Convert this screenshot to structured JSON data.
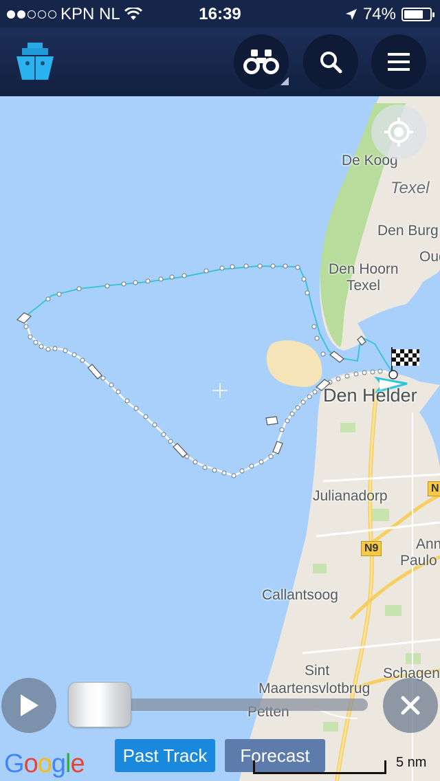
{
  "status_bar": {
    "carrier": "KPN NL",
    "signal_dots_filled": 2,
    "signal_dots_total": 5,
    "time": "16:39",
    "battery": "74%",
    "battery_level": 0.74
  },
  "app_bar": {
    "logo_icon": "ship-icon",
    "buttons": [
      "binoculars-icon",
      "search-icon",
      "hamburger-menu-icon"
    ]
  },
  "map": {
    "places": {
      "de_koog": "De Koog",
      "texel": "Texel",
      "den_burg": "Den Burg",
      "oud": "Oud",
      "den_hoorn": "Den Hoorn",
      "den_hoorn_texel": "Texel",
      "den_helder": "Den Helder",
      "julianadorp": "Julianadorp",
      "anna_paulowna_1": "Ann",
      "anna_paulowna_2": "Paulo",
      "callantsoog": "Callantsoog",
      "sint": "Sint",
      "maartensvlotbrug": "Maartensvlotbrug",
      "schagen": "Schagen",
      "petten": "Petten"
    },
    "road_signs": {
      "n9": "N9",
      "n_edge": "N"
    },
    "locate_icon": "crosshair-locate-icon"
  },
  "controls": {
    "play_icon": "play-icon",
    "close_icon": "close-icon",
    "slider_position": 0.0,
    "tabs": {
      "past_track": "Past Track",
      "forecast": "Forecast"
    },
    "active_tab": "past_track"
  },
  "footer": {
    "google": "Google",
    "scale": "5 nm"
  },
  "colors": {
    "sea": "#a9d0fa",
    "land": "#ede8df",
    "dunes": "#b8dc9c",
    "sand": "#f4e4b8",
    "track_forecast": "#3bc4d8",
    "track_past": "#ffffff",
    "active_tab": "#1a88dd",
    "inactive_tab": "#5d7cab",
    "header": "#16264a"
  }
}
